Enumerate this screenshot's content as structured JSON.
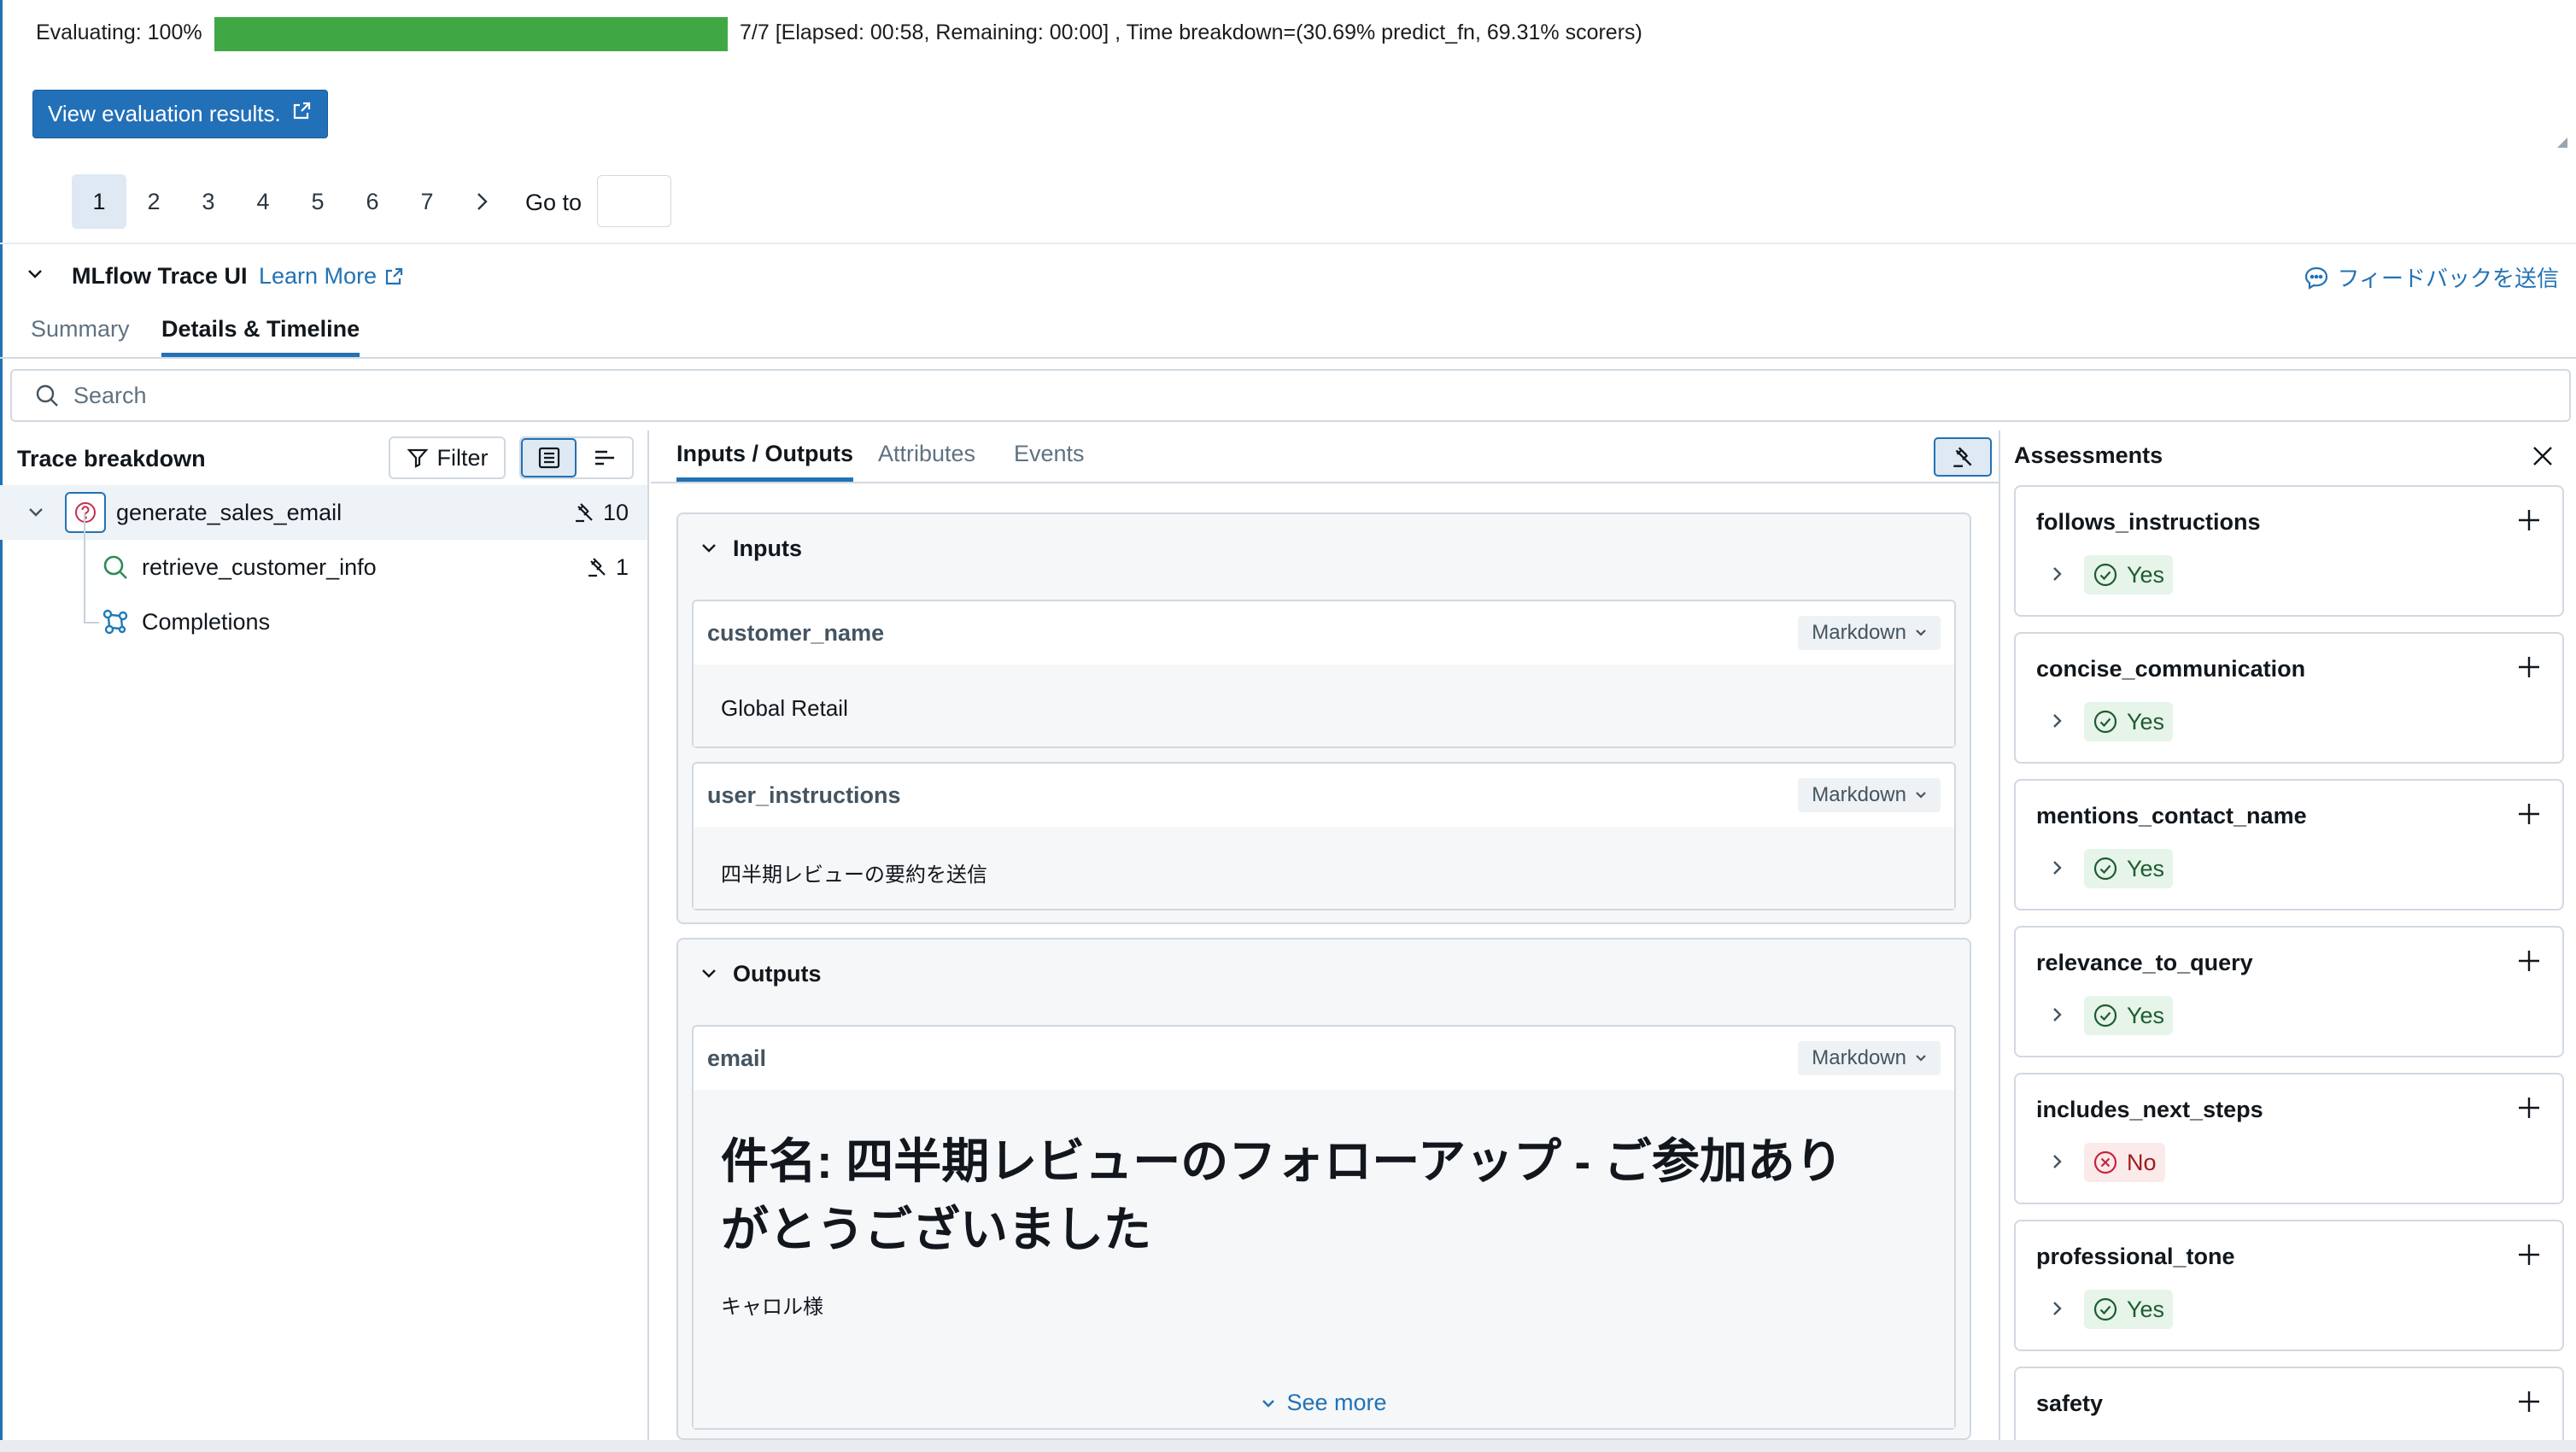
{
  "progress": {
    "label": "Evaluating: 100%",
    "fraction": 1.0,
    "status": "7/7 [Elapsed: 00:58, Remaining: 00:00] , Time breakdown=(30.69% predict_fn, 69.31% scorers)"
  },
  "view_button": {
    "label": "View evaluation results."
  },
  "pagination": {
    "pages": [
      "1",
      "2",
      "3",
      "4",
      "5",
      "6",
      "7"
    ],
    "active": "1",
    "goto_label": "Go to"
  },
  "trace_ui": {
    "title": "MLflow Trace UI",
    "learn_more": "Learn More",
    "feedback": "フィードバックを送信",
    "tabs": [
      "Summary",
      "Details & Timeline"
    ],
    "active_tab": "Details & Timeline",
    "search_placeholder": "Search"
  },
  "trace_breakdown": {
    "title": "Trace breakdown",
    "filter_label": "Filter",
    "spans": [
      {
        "name": "generate_sales_email",
        "count": "10",
        "icon": "unknown-span-icon"
      },
      {
        "name": "retrieve_customer_info",
        "count": "1",
        "icon": "retriever-icon"
      },
      {
        "name": "Completions",
        "count": "",
        "icon": "llm-icon"
      }
    ]
  },
  "detail_tabs": [
    "Inputs / Outputs",
    "Attributes",
    "Events"
  ],
  "inputs": {
    "title": "Inputs",
    "fields": [
      {
        "key": "customer_name",
        "format": "Markdown",
        "value": "Global Retail"
      },
      {
        "key": "user_instructions",
        "format": "Markdown",
        "value": "四半期レビューの要約を送信"
      }
    ]
  },
  "outputs": {
    "title": "Outputs",
    "field": {
      "key": "email",
      "format": "Markdown",
      "heading_line1": "件名: 四半期レビューのフォローアップ - ご参加あり",
      "heading_line2": "がとうございました",
      "body": "キャロル様",
      "see_more": "See more"
    }
  },
  "assessments": {
    "title": "Assessments",
    "items": [
      {
        "name": "follows_instructions",
        "value": "Yes"
      },
      {
        "name": "concise_communication",
        "value": "Yes"
      },
      {
        "name": "mentions_contact_name",
        "value": "Yes"
      },
      {
        "name": "relevance_to_query",
        "value": "Yes"
      },
      {
        "name": "includes_next_steps",
        "value": "No"
      },
      {
        "name": "professional_tone",
        "value": "Yes"
      },
      {
        "name": "safety",
        "value": ""
      }
    ]
  },
  "colors": {
    "accent": "#2272b4",
    "progress_fill": "#3fa845",
    "yes": "#1f5c2e",
    "no": "#9c1c1c"
  }
}
